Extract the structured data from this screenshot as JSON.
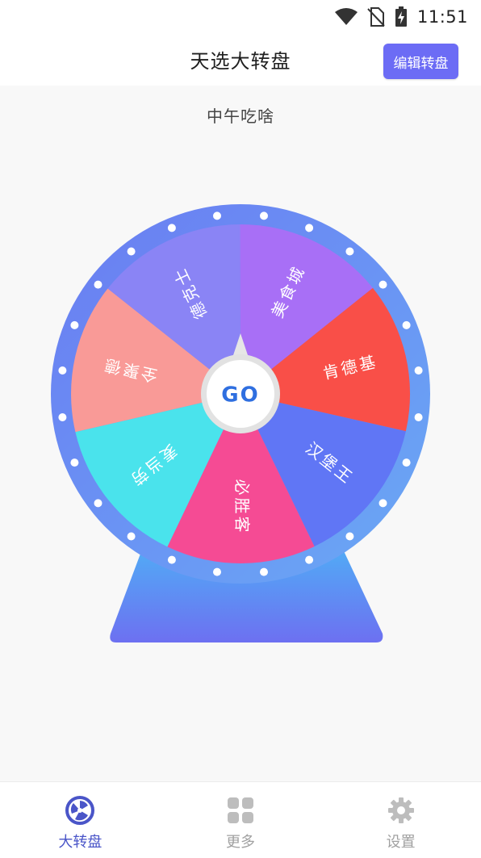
{
  "status_bar": {
    "time": "11:51"
  },
  "header": {
    "title": "天选大转盘",
    "edit_button": "编辑转盘"
  },
  "wheel": {
    "title": "中午吃啥",
    "go_label": "GO",
    "segments": [
      {
        "label": "全聚德",
        "color": "#f99a97"
      },
      {
        "label": "德克士",
        "color": "#8a84f5"
      },
      {
        "label": "美食城",
        "color": "#a86ff6"
      },
      {
        "label": "肯德基",
        "color": "#f94f48"
      },
      {
        "label": "汉堡王",
        "color": "#6076f5"
      },
      {
        "label": "必胜客",
        "color": "#f54b94"
      },
      {
        "label": "麦当劳",
        "color": "#4ae3ec"
      }
    ],
    "rim_color": "#6aa1f4",
    "stand_color": "#5d8cf6"
  },
  "tabs": [
    {
      "label": "大转盘",
      "icon": "wheel-icon",
      "active": true
    },
    {
      "label": "更多",
      "icon": "grid-icon",
      "active": false
    },
    {
      "label": "设置",
      "icon": "gear-icon",
      "active": false
    }
  ],
  "colors": {
    "accent": "#6c6cf5",
    "active_tab": "#4a55c8",
    "inactive_tab": "#a0a0a0"
  }
}
